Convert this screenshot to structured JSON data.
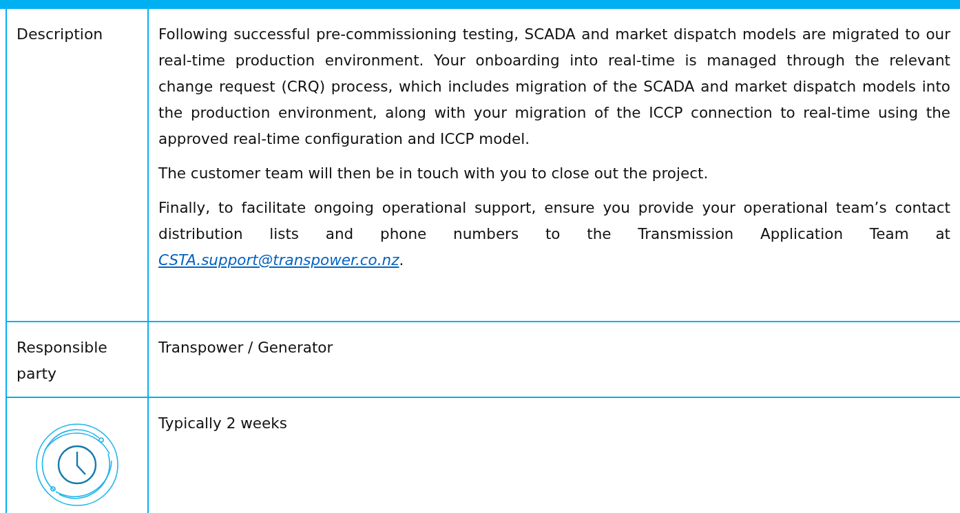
{
  "table": {
    "rows": [
      {
        "kind": "text",
        "label": "Description",
        "paragraphs": [
          {
            "text": "Following successful pre-commissioning testing, SCADA and market dispatch models are migrated to our real-time production environment. Your onboarding into real-time is managed through the relevant change request (CRQ) process, which includes migration of the SCADA and market dispatch models into the production environment, along with your migration of the ICCP connection to real-time using the approved real-time configuration and ICCP model."
          },
          {
            "text": "The customer team will then be in touch with you to close out the project."
          },
          {
            "text": "Finally, to facilitate ongoing operational support, ensure you provide your operational team’s contact distribution lists and phone numbers to the Transmission Application Team at ",
            "link": "CSTA.support@transpower.co.nz",
            "after": "."
          }
        ]
      },
      {
        "kind": "text",
        "label": "Responsible party",
        "paragraphs": [
          {
            "text": "Transpower / Generator"
          }
        ]
      },
      {
        "kind": "clock",
        "paragraphs": [
          {
            "text": "Typically 2 weeks"
          }
        ]
      }
    ]
  }
}
